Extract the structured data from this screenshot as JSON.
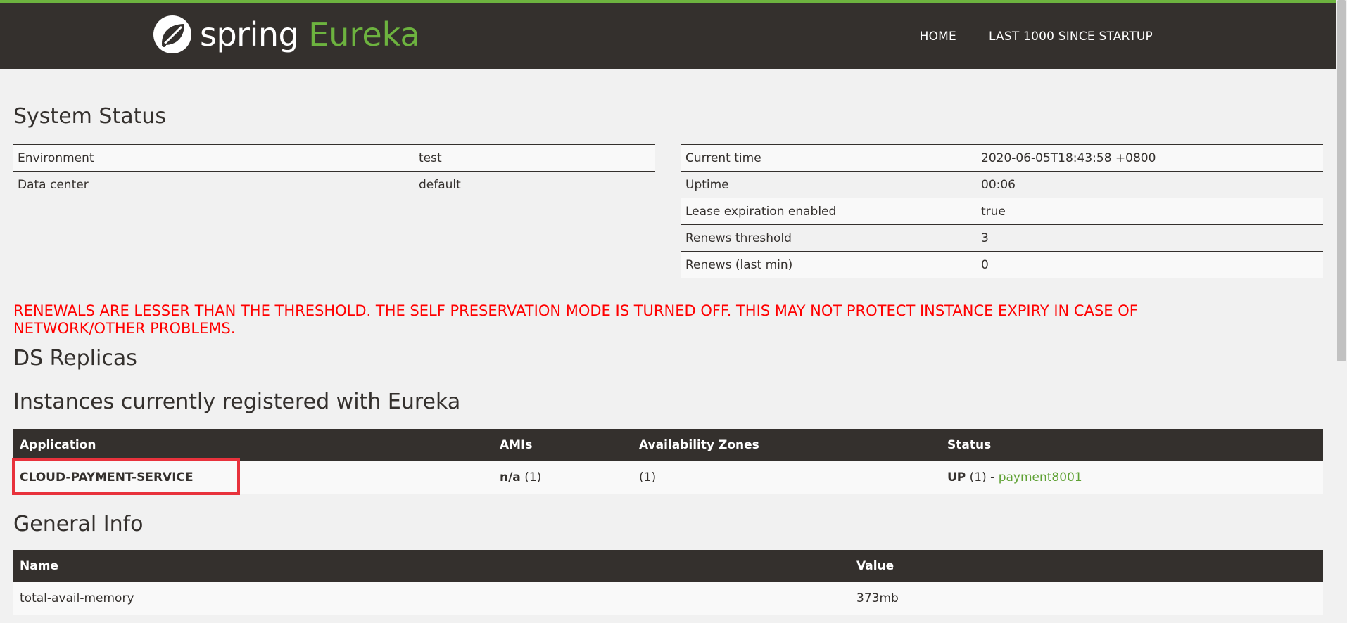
{
  "header": {
    "logo_spring": "spring",
    "logo_eureka": "Eureka",
    "nav": [
      "HOME",
      "LAST 1000 SINCE STARTUP"
    ]
  },
  "system_status": {
    "title": "System Status",
    "left": [
      {
        "label": "Environment",
        "value": "test"
      },
      {
        "label": "Data center",
        "value": "default"
      }
    ],
    "right": [
      {
        "label": "Current time",
        "value": "2020-06-05T18:43:58 +0800"
      },
      {
        "label": "Uptime",
        "value": "00:06"
      },
      {
        "label": "Lease expiration enabled",
        "value": "true"
      },
      {
        "label": "Renews threshold",
        "value": "3"
      },
      {
        "label": "Renews (last min)",
        "value": "0"
      }
    ]
  },
  "warning": "RENEWALS ARE LESSER THAN THE THRESHOLD. THE SELF PRESERVATION MODE IS TURNED OFF. THIS MAY NOT PROTECT INSTANCE EXPIRY IN CASE OF NETWORK/OTHER PROBLEMS.",
  "ds_replicas_title": "DS Replicas",
  "instances": {
    "title": "Instances currently registered with Eureka",
    "columns": [
      "Application",
      "AMIs",
      "Availability Zones",
      "Status"
    ],
    "rows": [
      {
        "application": "CLOUD-PAYMENT-SERVICE",
        "amis_bold": "n/a",
        "amis_count": " (1)",
        "zones": "(1)",
        "status_bold": "UP",
        "status_rest": " (1) - ",
        "status_link": "payment8001"
      }
    ]
  },
  "general_info": {
    "title": "General Info",
    "columns": [
      "Name",
      "Value"
    ],
    "rows": [
      {
        "name": "total-avail-memory",
        "value": "373mb"
      }
    ]
  },
  "colors": {
    "header_bg": "#34302d",
    "brand_green": "#6db33f",
    "warning_red": "#ff0000",
    "highlight_red": "#e8323c"
  }
}
